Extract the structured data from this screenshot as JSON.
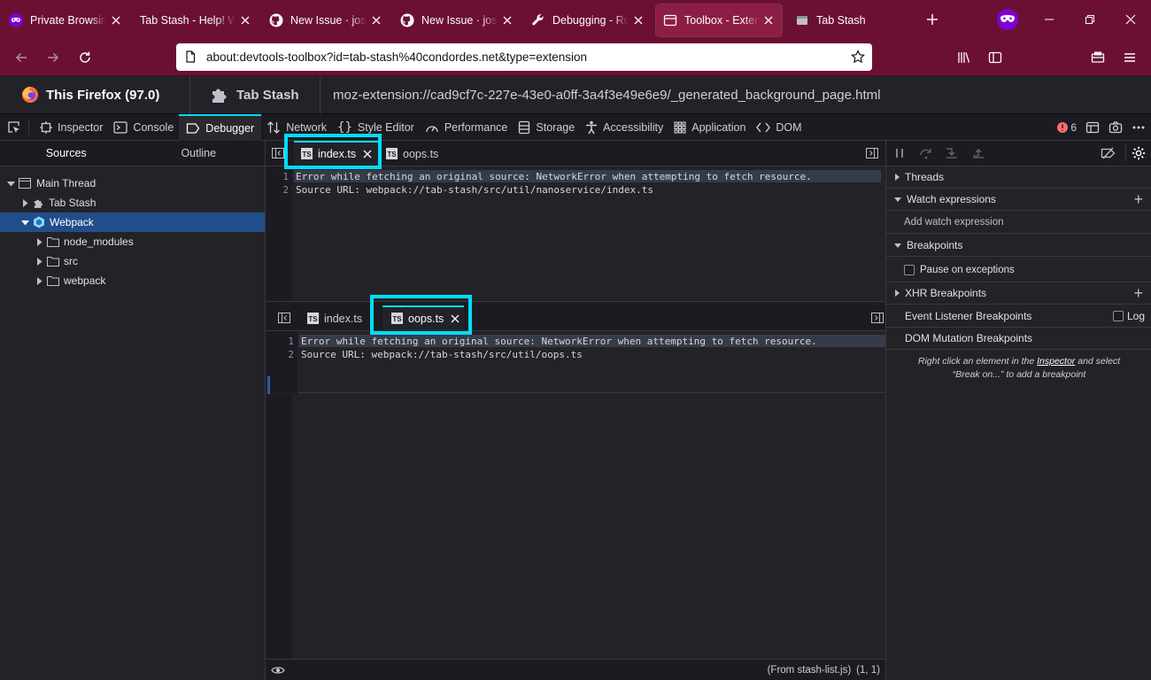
{
  "browser_tabs": [
    {
      "title": "Private Browsing",
      "icon": "private-mask-icon"
    },
    {
      "title": "Tab Stash - Help! Wh",
      "icon": "none"
    },
    {
      "title": "New Issue · josh-",
      "icon": "github-icon"
    },
    {
      "title": "New Issue · josh-",
      "icon": "github-icon"
    },
    {
      "title": "Debugging - Run",
      "icon": "wrench-icon"
    },
    {
      "title": "Toolbox - Extensi",
      "icon": "toolbox-icon"
    },
    {
      "title": "Tab Stash",
      "icon": "tabstash-icon"
    }
  ],
  "address_bar": {
    "url": "about:devtools-toolbox?id=tab-stash%40condordes.net&type=extension"
  },
  "target": {
    "runtime": "This Firefox (97.0)",
    "extension": "Tab Stash",
    "page_url": "moz-extension://cad9cf7c-227e-43e0-a0ff-3a4f3e49e6e9/_generated_background_page.html"
  },
  "tools": {
    "inspector": "Inspector",
    "console": "Console",
    "debugger": "Debugger",
    "network": "Network",
    "style_editor": "Style Editor",
    "performance": "Performance",
    "storage": "Storage",
    "accessibility": "Accessibility",
    "application": "Application",
    "dom": "DOM",
    "error_count": "6"
  },
  "sources_panel": {
    "tab_sources": "Sources",
    "tab_outline": "Outline",
    "tree": {
      "main_thread": "Main Thread",
      "tab_stash": "Tab Stash",
      "webpack": "Webpack",
      "node_modules": "node_modules",
      "src": "src",
      "webpack_dir": "webpack"
    }
  },
  "editor_top": {
    "tabs": {
      "first": "index.ts",
      "second": "oops.ts"
    },
    "lines": [
      {
        "num": "1",
        "text": "Error while fetching an original source: NetworkError when attempting to fetch resource."
      },
      {
        "num": "2",
        "text": "Source URL: webpack://tab-stash/src/util/nanoservice/index.ts"
      }
    ]
  },
  "editor_bottom": {
    "tabs": {
      "first": "index.ts",
      "second": "oops.ts"
    },
    "lines": [
      {
        "num": "1",
        "text": "Error while fetching an original source: NetworkError when attempting to fetch resource."
      },
      {
        "num": "2",
        "text": "Source URL: webpack://tab-stash/src/util/oops.ts"
      }
    ]
  },
  "footer": {
    "source_info": "(From stash-list.js)",
    "cursor": "(1, 1)"
  },
  "right_panel": {
    "threads": "Threads",
    "watch_expressions": "Watch expressions",
    "add_watch_expression": "Add watch expression",
    "breakpoints": "Breakpoints",
    "pause_on_exceptions": "Pause on exceptions",
    "xhr_breakpoints": "XHR Breakpoints",
    "event_listener_breakpoints": "Event Listener Breakpoints",
    "log": "Log",
    "dom_mutation_breakpoints": "DOM Mutation Breakpoints",
    "hint_prefix": "Right click an element in the ",
    "hint_link": "Inspector",
    "hint_suffix": " and select",
    "hint_line2": "“Break on...” to add a breakpoint"
  }
}
